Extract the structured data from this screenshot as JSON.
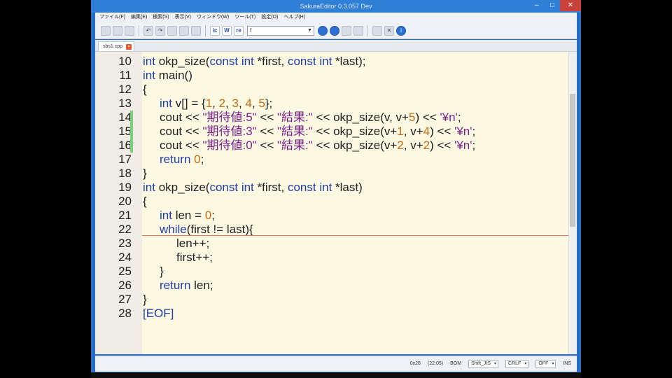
{
  "window": {
    "title": "SakuraEditor 0.3.057 Dev"
  },
  "menu": [
    "ファイル(F)",
    "編集(E)",
    "検索(S)",
    "表示(V)",
    "ウィンドウ(W)",
    "ツール(T)",
    "設定(O)",
    "ヘルプ(H)"
  ],
  "toolbar": {
    "search_value": "f",
    "kw_labels": [
      "ic",
      "W",
      "re"
    ]
  },
  "tab": {
    "label": "sbs1.cpp"
  },
  "editor": {
    "lines": [
      {
        "n": "10"
      },
      {
        "n": "11"
      },
      {
        "n": "12"
      },
      {
        "n": "13"
      },
      {
        "n": "14"
      },
      {
        "n": "15"
      },
      {
        "n": "16"
      },
      {
        "n": "17"
      },
      {
        "n": "18"
      },
      {
        "n": "19"
      },
      {
        "n": "20"
      },
      {
        "n": "21"
      },
      {
        "n": "22"
      },
      {
        "n": "23"
      },
      {
        "n": "24"
      },
      {
        "n": "25"
      },
      {
        "n": "26"
      },
      {
        "n": "27"
      },
      {
        "n": "28"
      }
    ],
    "code": {
      "l10": [
        "int",
        " okp_size(",
        "const",
        " ",
        "int",
        " *first, ",
        "const",
        " ",
        "int",
        " *last);"
      ],
      "l11": [
        "int",
        " main()"
      ],
      "l12": [
        "{"
      ],
      "l13": [
        "int",
        " v[] = {",
        "1",
        ", ",
        "2",
        ", ",
        "3",
        ", ",
        "4",
        ", ",
        "5",
        "};"
      ],
      "l14": [
        "cout << ",
        "\"期待値:5\"",
        " << ",
        "\"結果:\"",
        " << okp_size(v, v+",
        "5",
        ") << ",
        "'¥n'",
        ";"
      ],
      "l15": [
        "cout << ",
        "\"期待値:3\"",
        " << ",
        "\"結果:\"",
        " << okp_size(v+",
        "1",
        ", v+",
        "4",
        ") << ",
        "'¥n'",
        ";"
      ],
      "l16": [
        "cout << ",
        "\"期待値:0\"",
        " << ",
        "\"結果:\"",
        " << okp_size(v+",
        "2",
        ", v+",
        "2",
        ") << ",
        "'¥n'",
        ";"
      ],
      "l17": [
        "return",
        " ",
        "0",
        ";"
      ],
      "l18": [
        "}"
      ],
      "l19": [
        "int",
        " okp_size(",
        "const",
        " ",
        "int",
        " *first, ",
        "const",
        " ",
        "int",
        " *last)"
      ],
      "l20": [
        "{"
      ],
      "l21": [
        "int",
        " len = ",
        "0",
        ";"
      ],
      "l22": [
        "while",
        "(first != last){"
      ],
      "l23": [
        "len++;"
      ],
      "l24": [
        "first++;"
      ],
      "l25": [
        "}"
      ],
      "l26": [
        "return",
        " len;"
      ],
      "l27": [
        "}"
      ],
      "l28": [
        "[EOF]"
      ]
    }
  },
  "statusbar": {
    "pos": "0x28",
    "col": "(22:05)",
    "bom": "BOM",
    "encoding": "Shift_JIS",
    "eol": "CRLF",
    "ime": "OFF",
    "mode": "INS"
  }
}
